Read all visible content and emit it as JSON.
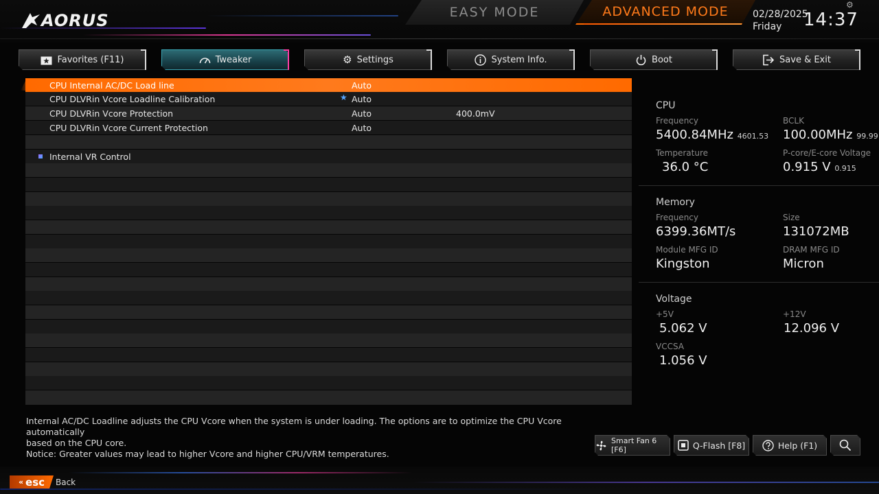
{
  "header": {
    "logo_text": "AORUS",
    "easy_mode": "EASY MODE",
    "advanced_mode": "ADVANCED MODE",
    "date": "02/28/2025",
    "day": "Friday",
    "time": "14:37",
    "accent": "#ff6a00"
  },
  "tabs": [
    {
      "label": "Favorites (F11)",
      "icon": "star-box-icon"
    },
    {
      "label": "Tweaker",
      "icon": "speedometer-icon"
    },
    {
      "label": "Settings",
      "icon": "gear-icon"
    },
    {
      "label": "System Info.",
      "icon": "info-icon"
    },
    {
      "label": "Boot",
      "icon": "power-icon"
    },
    {
      "label": "Save & Exit",
      "icon": "exit-icon"
    }
  ],
  "settings": [
    {
      "name": "CPU Internal AC/DC Load line",
      "value": "Auto",
      "extra": ""
    },
    {
      "name": "CPU DLVRin Vcore Loadline Calibration",
      "value": "Auto",
      "extra": ""
    },
    {
      "name": "CPU DLVRin Vcore Protection",
      "value": "Auto",
      "extra": "400.0mV"
    },
    {
      "name": "CPU DLVRin Vcore Current Protection",
      "value": "Auto",
      "extra": ""
    },
    {
      "name": "",
      "value": "",
      "extra": ""
    },
    {
      "name": "Internal VR Control",
      "value": "",
      "extra": ""
    }
  ],
  "panel": {
    "cpu": {
      "title": "CPU",
      "freq_label": "Frequency",
      "freq": "5400.84MHz",
      "freq_small": "4601.53",
      "bclk_label": "BCLK",
      "bclk": "100.00MHz",
      "bclk_small": "99.99",
      "temp_label": "Temperature",
      "temp": "36.0 °C",
      "volt_label": "P-core/E-core Voltage",
      "volt": "0.915 V",
      "volt_small": "0.915"
    },
    "memory": {
      "title": "Memory",
      "freq_label": "Frequency",
      "freq": "6399.36MT/s",
      "size_label": "Size",
      "size": "131072MB",
      "module_label": "Module MFG ID",
      "module": "Kingston",
      "dram_label": "DRAM MFG ID",
      "dram": "Micron"
    },
    "voltage": {
      "title": "Voltage",
      "v5_label": "+5V",
      "v5": "5.062 V",
      "v12_label": "+12V",
      "v12": "12.096 V",
      "vccsa_label": "VCCSA",
      "vccsa": "1.056 V"
    }
  },
  "help": {
    "line1": "Internal AC/DC Loadline adjusts the CPU Vcore when the system is under loading. The options are to optimize the CPU Vcore automatically",
    "line2": "based on the CPU core.",
    "line3": "Notice: Greater values may lead to higher Vcore and higher CPU/VRM temperatures."
  },
  "bottom_buttons": {
    "smart_fan": "Smart Fan 6 [F6]",
    "qflash": "Q-Flash [F8]",
    "help": "Help (F1)"
  },
  "footer": {
    "esc": "esc",
    "back": "Back"
  }
}
